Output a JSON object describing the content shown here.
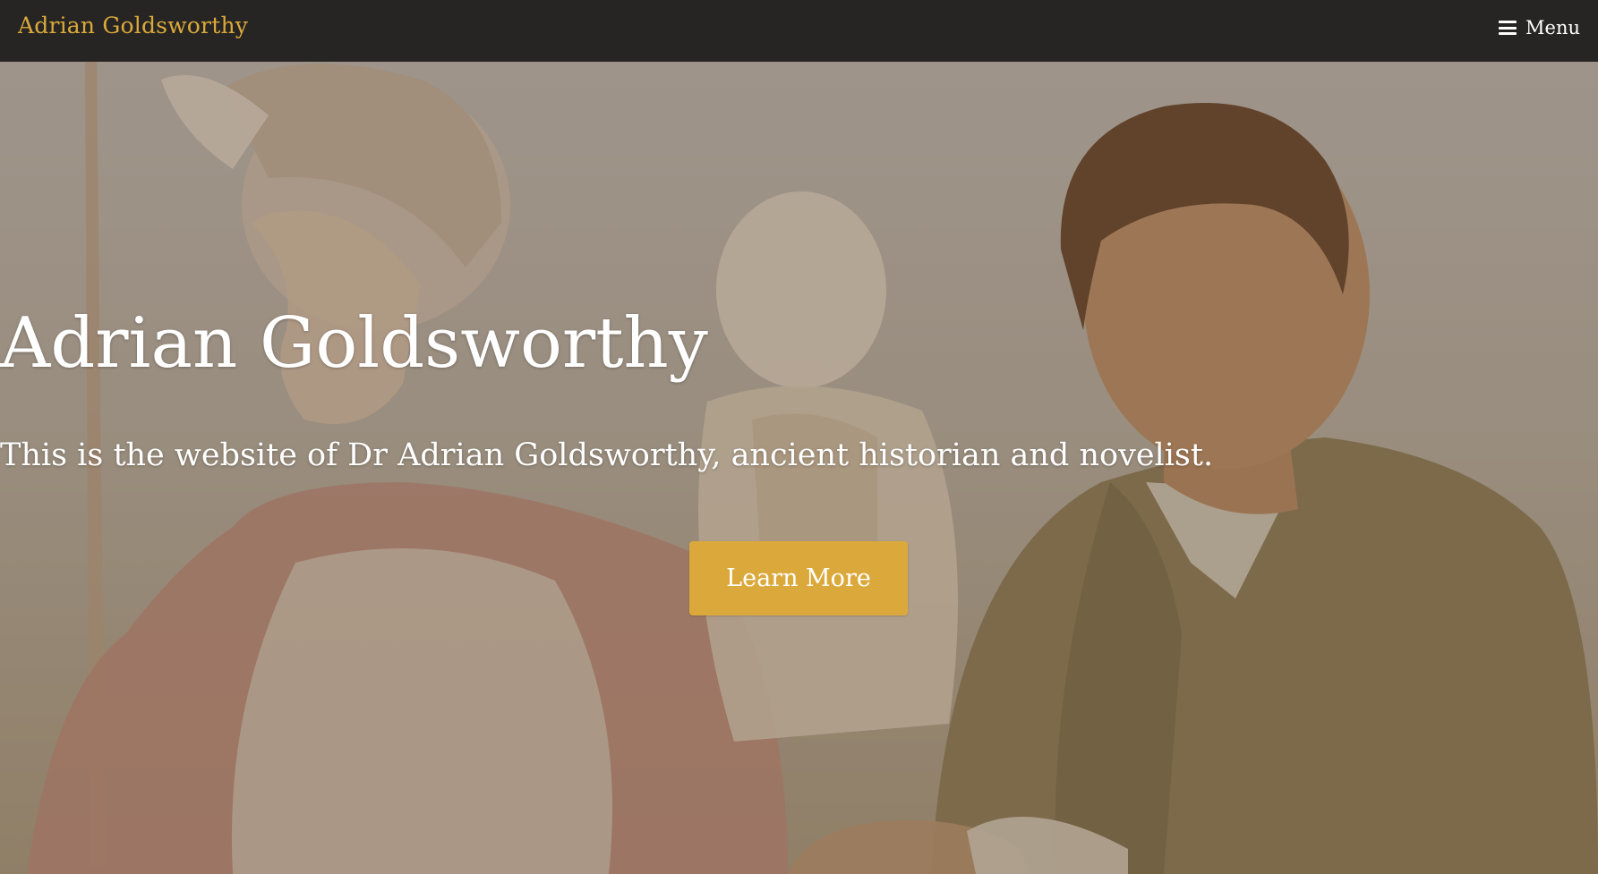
{
  "navbar": {
    "brand": "Adrian Goldsworthy",
    "menu_label": "Menu",
    "menu_icon": "bars-icon"
  },
  "hero": {
    "title": "Adrian Goldsworthy",
    "subtitle": "This is the website of Dr Adrian Goldsworthy, ancient historian and novelist.",
    "cta_label": "Learn More",
    "background_image": "illustration of a Roman soldier and a statue of Augustus beside a photo of the author"
  },
  "colors": {
    "accent": "#dba93b",
    "navbar_bg": "#272523",
    "text_light": "#ffffff"
  }
}
